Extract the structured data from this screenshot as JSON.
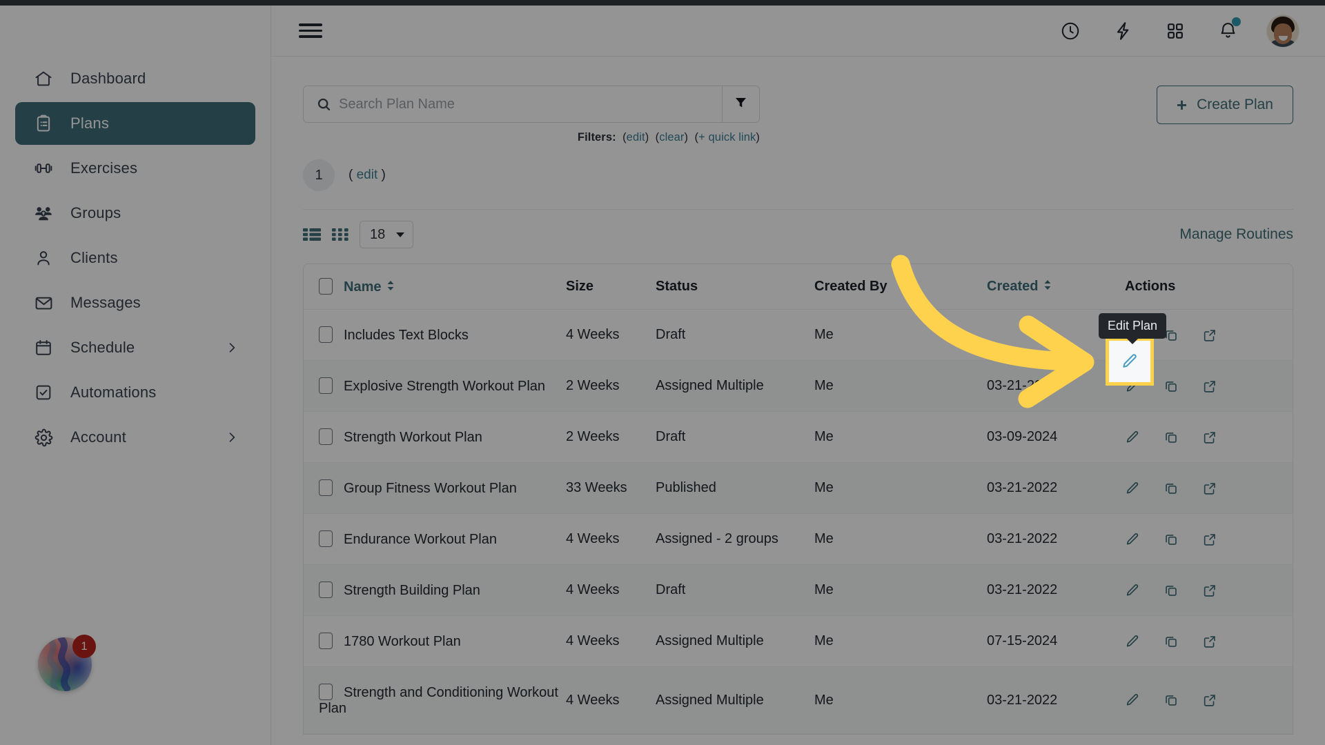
{
  "topbar": {
    "hamburger_icon": "hamburger-menu-icon",
    "icons": [
      {
        "name": "clock-icon",
        "label": "History"
      },
      {
        "name": "lightning-icon",
        "label": "Quick Actions"
      },
      {
        "name": "grid-apps-icon",
        "label": "Apps"
      },
      {
        "name": "bell-icon",
        "label": "Notifications",
        "dot": true,
        "dot_color": "#2e9ab0"
      }
    ],
    "avatar_name": "user-avatar"
  },
  "sidebar": {
    "items": [
      {
        "label": "Dashboard",
        "icon": "home-icon",
        "active": false,
        "chevron": false
      },
      {
        "label": "Plans",
        "icon": "clipboard-icon",
        "active": true,
        "chevron": false
      },
      {
        "label": "Exercises",
        "icon": "dumbbell-icon",
        "active": false,
        "chevron": false
      },
      {
        "label": "Groups",
        "icon": "people-icon",
        "active": false,
        "chevron": false
      },
      {
        "label": "Clients",
        "icon": "person-icon",
        "active": false,
        "chevron": false
      },
      {
        "label": "Messages",
        "icon": "envelope-icon",
        "active": false,
        "chevron": false
      },
      {
        "label": "Schedule",
        "icon": "calendar-icon",
        "active": false,
        "chevron": true
      },
      {
        "label": "Automations",
        "icon": "checkbox-icon",
        "active": false,
        "chevron": false
      },
      {
        "label": "Account",
        "icon": "gear-icon",
        "active": false,
        "chevron": true
      }
    ],
    "active_color": "#3e6d78",
    "brand_badge_count": "1"
  },
  "search": {
    "placeholder": "Search Plan Name",
    "value": "",
    "search_icon": "search-icon",
    "filter_icon": "funnel-filter-icon"
  },
  "filters": {
    "label": "Filters:",
    "edit": "edit",
    "clear": "clear",
    "quick_link": "+ quick link",
    "link_color": "#3d7f95"
  },
  "create_button": {
    "label": "Create Plan",
    "plus": "+"
  },
  "pagination": {
    "count": "1",
    "edit": "edit",
    "open_paren": "(",
    "close_paren": ")"
  },
  "viewbar": {
    "list_view_icon": "list-view-icon",
    "grid_view_icon": "grid-view-icon",
    "per_page": "18",
    "manage_routines": "Manage Routines"
  },
  "table": {
    "columns": [
      {
        "label": "Name",
        "sortable": true,
        "key": "name"
      },
      {
        "label": "Size",
        "sortable": false,
        "key": "size"
      },
      {
        "label": "Status",
        "sortable": false,
        "key": "status"
      },
      {
        "label": "Created By",
        "sortable": false,
        "key": "created_by"
      },
      {
        "label": "Created",
        "sortable": true,
        "key": "created"
      },
      {
        "label": "Actions",
        "sortable": false,
        "key": "actions"
      }
    ],
    "rows": [
      {
        "name": "Includes Text Blocks",
        "size": "4 Weeks",
        "status": "Draft",
        "created_by": "Me",
        "created": ""
      },
      {
        "name": "Explosive Strength Workout Plan",
        "size": "2 Weeks",
        "status": "Assigned Multiple",
        "created_by": "Me",
        "created": "03-21-2022"
      },
      {
        "name": "Strength Workout Plan",
        "size": "2 Weeks",
        "status": "Draft",
        "created_by": "Me",
        "created": "03-09-2024"
      },
      {
        "name": "Group Fitness Workout Plan",
        "size": "33 Weeks",
        "status": "Published",
        "created_by": "Me",
        "created": "03-21-2022"
      },
      {
        "name": "Endurance Workout Plan",
        "size": "4 Weeks",
        "status": "Assigned - 2 groups",
        "created_by": "Me",
        "created": "03-21-2022"
      },
      {
        "name": "Strength Building Plan",
        "size": "4 Weeks",
        "status": "Draft",
        "created_by": "Me",
        "created": "03-21-2022"
      },
      {
        "name": "1780 Workout Plan",
        "size": "4 Weeks",
        "status": "Assigned Multiple",
        "created_by": "Me",
        "created": "07-15-2024"
      },
      {
        "name": "Strength and Conditioning Workout Plan",
        "size": "4 Weeks",
        "status": "Assigned Multiple",
        "created_by": "Me",
        "created": "03-21-2022"
      }
    ],
    "action_icons": [
      "edit-pencil-icon",
      "duplicate-icon",
      "open-external-icon"
    ],
    "accent_color": "#3e6d78"
  },
  "callout": {
    "tooltip_text": "Edit Plan",
    "highlight_color": "#ffd24d",
    "arrow_color": "#ffd24d",
    "arrow_name": "annotation-arrow"
  }
}
